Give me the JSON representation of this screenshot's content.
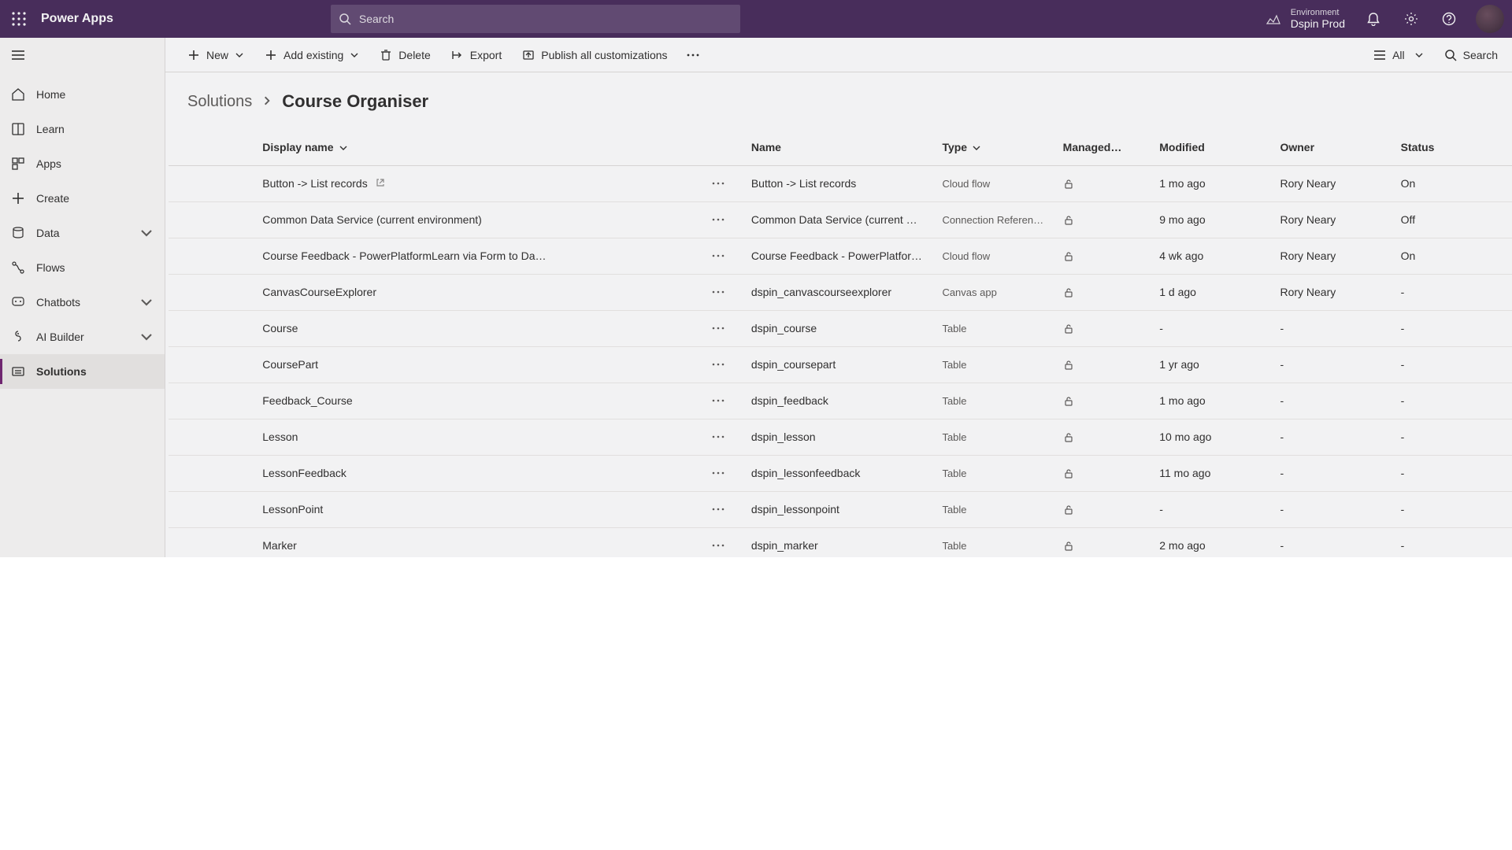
{
  "header": {
    "brand": "Power Apps",
    "search_placeholder": "Search",
    "env_label": "Environment",
    "env_name": "Dspin Prod"
  },
  "sidebar": {
    "items": [
      {
        "label": "Home"
      },
      {
        "label": "Learn"
      },
      {
        "label": "Apps"
      },
      {
        "label": "Create"
      },
      {
        "label": "Data",
        "expandable": true
      },
      {
        "label": "Flows"
      },
      {
        "label": "Chatbots",
        "expandable": true
      },
      {
        "label": "AI Builder",
        "expandable": true
      },
      {
        "label": "Solutions",
        "active": true
      }
    ]
  },
  "commandbar": {
    "new": "New",
    "add_existing": "Add existing",
    "delete": "Delete",
    "export": "Export",
    "publish_all": "Publish all customizations",
    "filter_label": "All",
    "search": "Search"
  },
  "breadcrumb": {
    "root": "Solutions",
    "current": "Course Organiser"
  },
  "table": {
    "headers": {
      "display_name": "Display name",
      "name": "Name",
      "type": "Type",
      "managed": "Managed…",
      "modified": "Modified",
      "owner": "Owner",
      "status": "Status"
    },
    "rows": [
      {
        "display_name": "Button -> List records",
        "external": true,
        "name": "Button -> List records",
        "type": "Cloud flow",
        "managed_locked": true,
        "modified": "1 mo ago",
        "owner": "Rory Neary",
        "status": "On"
      },
      {
        "display_name": "Common Data Service (current environment)",
        "name": "Common Data Service (current environment)",
        "type": "Connection Reference",
        "managed_locked": true,
        "modified": "9 mo ago",
        "owner": "Rory Neary",
        "status": "Off"
      },
      {
        "display_name": "Course Feedback - PowerPlatformLearn via Form to Da…",
        "name": "Course Feedback - PowerPlatformLearn",
        "type": "Cloud flow",
        "managed_locked": true,
        "modified": "4 wk ago",
        "owner": "Rory Neary",
        "status": "On"
      },
      {
        "display_name": "CanvasCourseExplorer",
        "name": "dspin_canvascourseexplorer",
        "type": "Canvas app",
        "managed_locked": true,
        "modified": "1 d ago",
        "owner": "Rory Neary",
        "status": "-"
      },
      {
        "display_name": "Course",
        "name": "dspin_course",
        "type": "Table",
        "managed_locked": true,
        "modified": "-",
        "owner": "-",
        "status": "-"
      },
      {
        "display_name": "CoursePart",
        "name": "dspin_coursepart",
        "type": "Table",
        "managed_locked": true,
        "modified": "1 yr ago",
        "owner": "-",
        "status": "-"
      },
      {
        "display_name": "Feedback_Course",
        "name": "dspin_feedback",
        "type": "Table",
        "managed_locked": true,
        "modified": "1 mo ago",
        "owner": "-",
        "status": "-"
      },
      {
        "display_name": "Lesson",
        "name": "dspin_lesson",
        "type": "Table",
        "managed_locked": true,
        "modified": "10 mo ago",
        "owner": "-",
        "status": "-"
      },
      {
        "display_name": "LessonFeedback",
        "name": "dspin_lessonfeedback",
        "type": "Table",
        "managed_locked": true,
        "modified": "11 mo ago",
        "owner": "-",
        "status": "-"
      },
      {
        "display_name": "LessonPoint",
        "name": "dspin_lessonpoint",
        "type": "Table",
        "managed_locked": true,
        "modified": "-",
        "owner": "-",
        "status": "-"
      },
      {
        "display_name": "Marker",
        "name": "dspin_marker",
        "type": "Table",
        "managed_locked": true,
        "modified": "2 mo ago",
        "owner": "-",
        "status": "-"
      }
    ]
  }
}
